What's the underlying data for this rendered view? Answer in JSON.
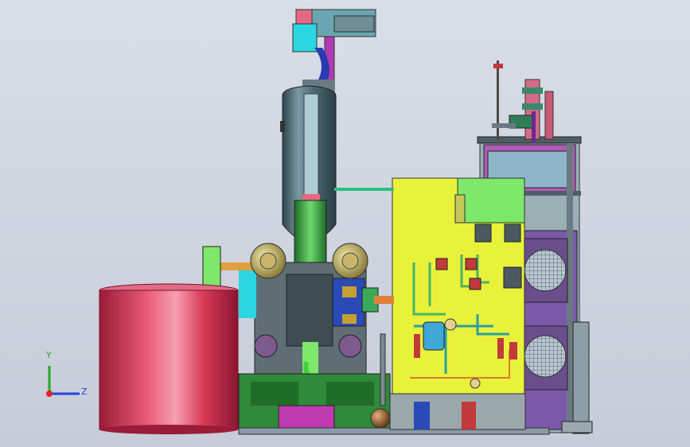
{
  "viewport": {
    "background_top": "#d9dde7",
    "background_bottom": "#c8ccd8"
  },
  "triad": {
    "y_label": "Y",
    "z_label": "Z",
    "y_color": "#22aa22",
    "z_color": "#2244dd",
    "x_color": "#dd2222"
  },
  "colors": {
    "yellow_panel": "#e8f23a",
    "red_tank": "#d83a55",
    "vessel": "#4d6e79",
    "green_pipe": "#3faa3f",
    "base_green": "#2f8a3a",
    "machinery_gray": "#5e6e74",
    "magenta": "#b03ab0",
    "cyan": "#2ad6e0",
    "fan_grille": "#8a9aa6"
  }
}
